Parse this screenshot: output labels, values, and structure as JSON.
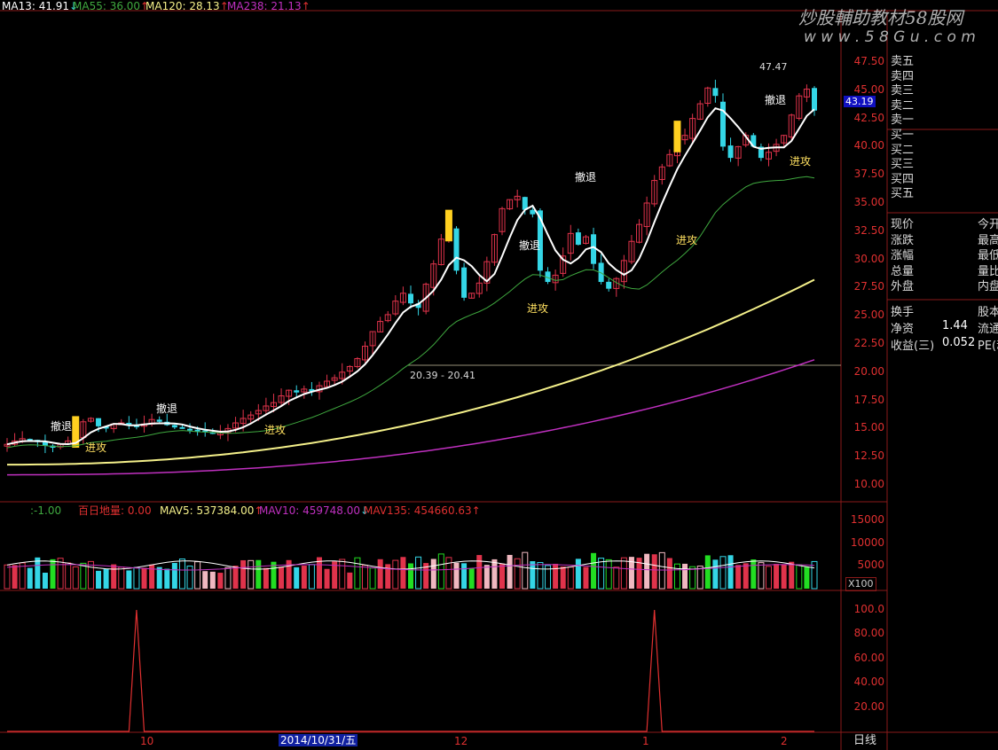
{
  "colors": {
    "up": "#e0334b",
    "down": "#34d6e6",
    "ma13": "#ffffff",
    "ma55": "#3fa83f",
    "ma120": "#f4f08a",
    "ma238": "#c030c0",
    "grid": "#8a1a1a",
    "signal_buy": "#ffd020",
    "accent_tag": "#1010c0",
    "vol_green": "#22dd22",
    "vol_pink": "#f0b8c0"
  },
  "legend_top": {
    "ma13": "MA13: 41.91",
    "ma13_arrow": "↓",
    "ma55": "MA55: 36.00",
    "ma55_arrow": "↑",
    "ma120": "MA120: 28.13",
    "ma120_arrow": "↑",
    "ma238": "MA238: 21.13",
    "ma238_arrow": "↑"
  },
  "watermark": {
    "title": "炒股輔助教材58股网",
    "url": "w w w . 5 8 G u . c o m"
  },
  "price_axis": [
    "47.50",
    "45.00",
    "42.50",
    "40.00",
    "37.50",
    "35.00",
    "32.50",
    "30.00",
    "27.50",
    "25.00",
    "22.50",
    "20.00",
    "17.50",
    "15.00",
    "12.50",
    "10.00"
  ],
  "current_price_tag": "43.19",
  "annotations": {
    "high": "47.47",
    "range": "20.39 - 20.41",
    "retreat": "撤退",
    "attack": "进攻"
  },
  "order_book": [
    "卖五",
    "卖四",
    "卖三",
    "卖二",
    "卖一",
    "买一",
    "买二",
    "买三",
    "买四",
    "买五"
  ],
  "quote_rows": [
    {
      "left": "现价",
      "right": "今开"
    },
    {
      "left": "涨跌",
      "right": "最高"
    },
    {
      "left": "涨幅",
      "right": "最低"
    },
    {
      "left": "总量",
      "right": "量比"
    },
    {
      "left": "外盘",
      "right": "内盘"
    }
  ],
  "fund_rows": [
    {
      "left": "换手",
      "mid": "",
      "right": "股本"
    },
    {
      "left": "净资",
      "mid": "1.44",
      "right": "流通"
    },
    {
      "left": "收益(三)",
      "mid": "0.052",
      "right": "PE(动)"
    }
  ],
  "volume_legend": {
    "val": ":-1.00",
    "name": "百日地量: 0.00",
    "mav5": "MAV5: 537384.00",
    "mav5_arrow": "↑",
    "mav10": "MAV10: 459748.00",
    "mav10_arrow": "↓",
    "mav135": "MAV135: 454660.63",
    "mav135_arrow": "↑"
  },
  "volume_axis": [
    "15000",
    "10000",
    "5000"
  ],
  "volume_unit": "X100",
  "indicator_axis": [
    "100.0",
    "80.00",
    "60.00",
    "40.00",
    "20.00"
  ],
  "date_axis": [
    "10",
    "2014/10/31/五",
    "12",
    "1",
    "2"
  ],
  "period_label": "日线",
  "chart_data": {
    "type": "candlestick",
    "ylim": [
      9,
      49
    ],
    "closes_approx": [
      13.6,
      13.9,
      14.1,
      14.0,
      13.8,
      13.5,
      13.3,
      13.6,
      13.9,
      14.3,
      15.6,
      15.9,
      15.2,
      15.0,
      15.4,
      15.5,
      15.3,
      15.2,
      15.4,
      15.8,
      15.6,
      15.3,
      15.1,
      15.0,
      14.9,
      14.8,
      14.7,
      14.6,
      14.6,
      15.0,
      15.5,
      15.9,
      16.2,
      16.6,
      17.0,
      17.3,
      17.9,
      18.4,
      18.2,
      18.5,
      18.3,
      18.8,
      19.2,
      19.5,
      20.0,
      20.5,
      21.2,
      22.3,
      23.6,
      24.5,
      25.1,
      26.3,
      27.0,
      26.1,
      25.7,
      27.8,
      29.6,
      31.8,
      32.6,
      29.0,
      26.6,
      27.0,
      27.9,
      29.8,
      32.2,
      34.5,
      35.3,
      35.6,
      34.4,
      34.0,
      29.0,
      28.0,
      28.6,
      30.3,
      32.3,
      31.3,
      32.0,
      29.6,
      28.0,
      27.4,
      28.3,
      29.9,
      31.6,
      33.1,
      35.0,
      37.0,
      38.2,
      39.3,
      40.5,
      41.0,
      42.5,
      43.8,
      45.2,
      44.5,
      40.0,
      39.0,
      40.0,
      41.0,
      40.0,
      39.0,
      39.5,
      40.2,
      41.0,
      42.8,
      44.5,
      45.1,
      43.2
    ],
    "peak_series": [
      {
        "name": "百日地量",
        "peaks": [
          {
            "index": 17,
            "value": 100
          },
          {
            "index": 85,
            "value": 100
          }
        ]
      }
    ]
  }
}
